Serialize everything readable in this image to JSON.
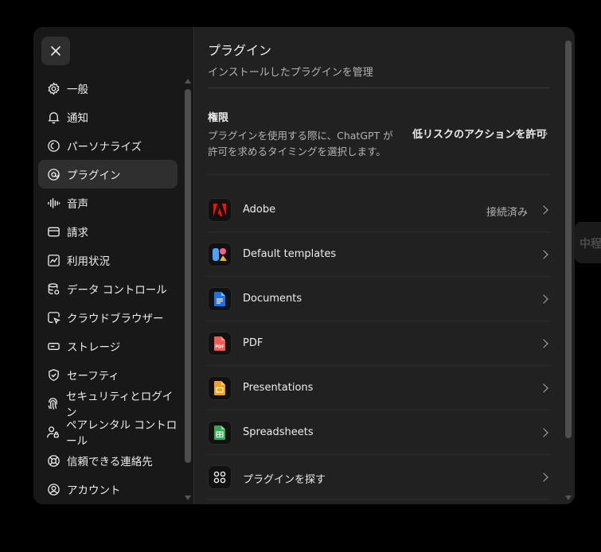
{
  "background_tag": "中程",
  "sidebar": {
    "items": [
      {
        "label": "一般",
        "icon": "gear-icon"
      },
      {
        "label": "通知",
        "icon": "bell-icon"
      },
      {
        "label": "パーソナライズ",
        "icon": "personalize-icon"
      },
      {
        "label": "プラグイン",
        "icon": "plugin-icon",
        "active": true
      },
      {
        "label": "音声",
        "icon": "voice-wave-icon"
      },
      {
        "label": "請求",
        "icon": "credit-card-icon"
      },
      {
        "label": "利用状況",
        "icon": "chart-icon"
      },
      {
        "label": "データ コントロール",
        "icon": "database-icon"
      },
      {
        "label": "クラウドブラウザー",
        "icon": "cloud-browser-icon"
      },
      {
        "label": "ストレージ",
        "icon": "storage-icon"
      },
      {
        "label": "セーフティ",
        "icon": "shield-check-icon"
      },
      {
        "label": "セキュリティとログイン",
        "icon": "fingerprint-icon"
      },
      {
        "label": "ペアレンタル コントロール",
        "icon": "parental-icon"
      },
      {
        "label": "信頼できる連絡先",
        "icon": "lifebuoy-icon"
      },
      {
        "label": "アカウント",
        "icon": "user-circle-icon"
      }
    ]
  },
  "main": {
    "title": "プラグイン",
    "subtitle": "インストールしたプラグインを管理",
    "permission": {
      "label": "権限",
      "description": "プラグインを使用する際に、ChatGPT が許可を求めるタイミングを選択します。",
      "value": "低リスクのアクションを許可"
    },
    "plugins": [
      {
        "name": "Adobe",
        "status": "接続済み",
        "icon": "adobe-icon"
      },
      {
        "name": "Default templates",
        "status": "",
        "icon": "templates-icon"
      },
      {
        "name": "Documents",
        "status": "",
        "icon": "documents-icon"
      },
      {
        "name": "PDF",
        "status": "",
        "icon": "pdf-icon"
      },
      {
        "name": "Presentations",
        "status": "",
        "icon": "presentations-icon"
      },
      {
        "name": "Spreadsheets",
        "status": "",
        "icon": "spreadsheets-icon"
      },
      {
        "name": "プラグインを探す",
        "status": "",
        "icon": "discover-icon"
      }
    ]
  },
  "colors": {
    "dialog_bg": "#212121",
    "sidebar_bg": "#181818",
    "active_item": "#2f2f2f",
    "adobe_red": "#fa0f00",
    "docs_blue": "#1a73e8",
    "pdf_red": "#f25c54",
    "slides_orange": "#f4b400",
    "sheets_green": "#34a853"
  }
}
